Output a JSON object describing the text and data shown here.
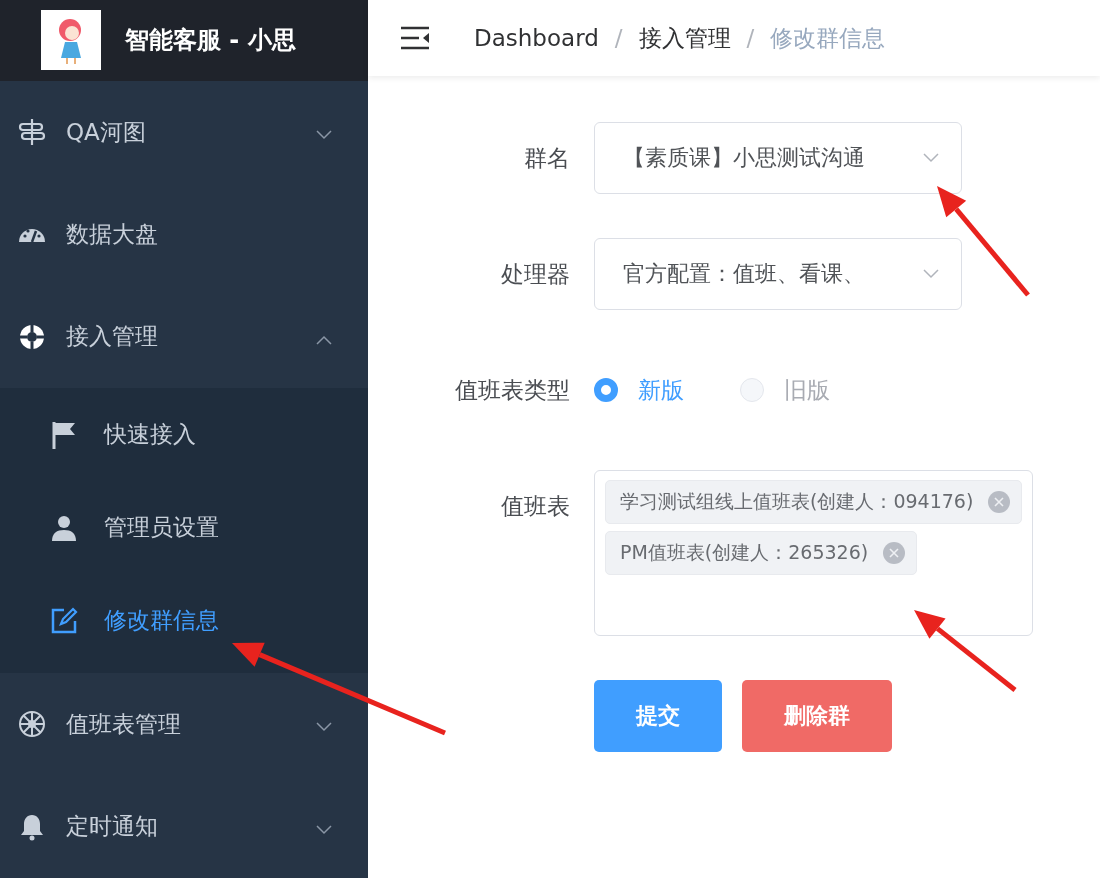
{
  "sidebar": {
    "title": "智能客服 - 小思",
    "items": [
      {
        "label": "QA河图",
        "expanded": false
      },
      {
        "label": "数据大盘"
      },
      {
        "label": "接入管理",
        "expanded": true,
        "children": [
          {
            "label": "快速接入",
            "selected": false
          },
          {
            "label": "管理员设置",
            "selected": false
          },
          {
            "label": "修改群信息",
            "selected": true
          }
        ]
      },
      {
        "label": "值班表管理",
        "expanded": false
      },
      {
        "label": "定时通知",
        "expanded": false
      }
    ]
  },
  "breadcrumb": {
    "items": [
      "Dashboard",
      "接入管理",
      "修改群信息"
    ],
    "separators": [
      "/",
      "/"
    ]
  },
  "form": {
    "fields": [
      {
        "kind": "select",
        "label": "群名",
        "value": "【素质课】小思测试沟通"
      },
      {
        "kind": "select",
        "label": "处理器",
        "value": "官方配置：值班、看课、"
      },
      {
        "kind": "radio",
        "label": "值班表类型",
        "options": [
          {
            "label": "新版",
            "selected": true
          },
          {
            "label": "旧版",
            "selected": false
          }
        ]
      },
      {
        "kind": "tags",
        "label": "值班表",
        "tags": [
          "学习测试组线上值班表(创建人：094176)",
          "PM值班表(创建人：265326)"
        ]
      }
    ],
    "buttons": [
      {
        "label": "提交",
        "kind": "primary"
      },
      {
        "label": "删除群",
        "kind": "danger"
      }
    ]
  }
}
